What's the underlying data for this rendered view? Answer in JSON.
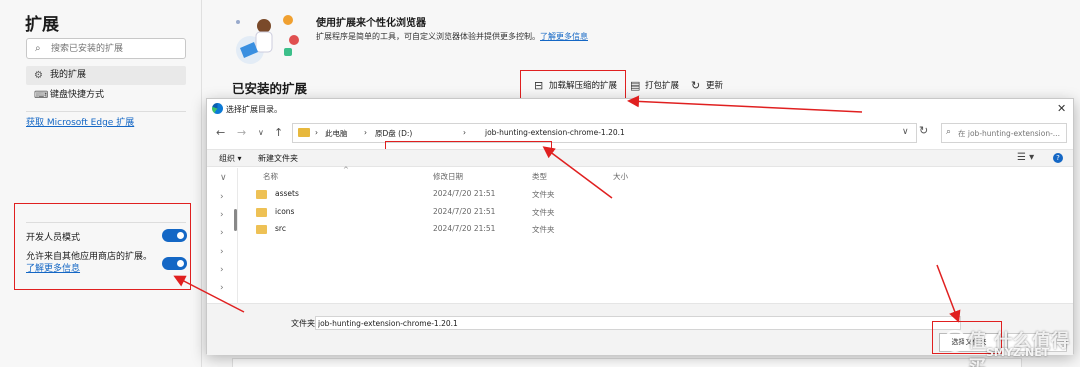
{
  "sidebar": {
    "title": "扩展",
    "search_placeholder": "搜索已安装的扩展",
    "items": [
      {
        "label": "我的扩展",
        "icon": "extensions-icon",
        "selected": true
      },
      {
        "label": "键盘快捷方式",
        "icon": "keyboard-icon",
        "selected": false
      }
    ],
    "get_extensions_link": "获取 Microsoft Edge 扩展",
    "developer_mode_label": "开发人员模式",
    "developer_mode_on": true,
    "allow_other_stores_label": "允许来自其他应用商店的扩展。",
    "learn_more": "了解更多信息",
    "allow_other_stores_on": true
  },
  "main": {
    "hero_title": "使用扩展来个性化浏览器",
    "hero_desc": "扩展程序是简单的工具，可自定义浏览器体验并提供更多控制。",
    "hero_learn_more": "了解更多信息",
    "installed_title": "已安装的扩展",
    "toolbar": {
      "load_unpacked": "加载解压缩的扩展",
      "pack": "打包扩展",
      "update": "更新"
    }
  },
  "dialog": {
    "title": "选择扩展目录。",
    "breadcrumb": [
      "此电脑",
      "原D盘 (D:)",
      "job-hunting-extension-chrome-1.20.1"
    ],
    "search_placeholder": "在 job-hunting-extension-...",
    "commands": {
      "organize": "组织 ▾",
      "new_folder": "新建文件夹"
    },
    "columns": [
      "名称",
      "修改日期",
      "类型",
      "大小"
    ],
    "files": [
      {
        "name": "assets",
        "date": "2024/7/20 21:51",
        "type": "文件夹"
      },
      {
        "name": "icons",
        "date": "2024/7/20 21:51",
        "type": "文件夹"
      },
      {
        "name": "src",
        "date": "2024/7/20 21:51",
        "type": "文件夹"
      }
    ],
    "folder_label": "文件夹:",
    "folder_value": "job-hunting-extension-chrome-1.20.1",
    "select_button": "选择文件夹"
  },
  "watermark": {
    "main": "值 什么值得买",
    "sub": "SMYZ.NET"
  },
  "colors": {
    "accent": "#1467c5",
    "annotation": "#e02020",
    "folder": "#eec155"
  }
}
